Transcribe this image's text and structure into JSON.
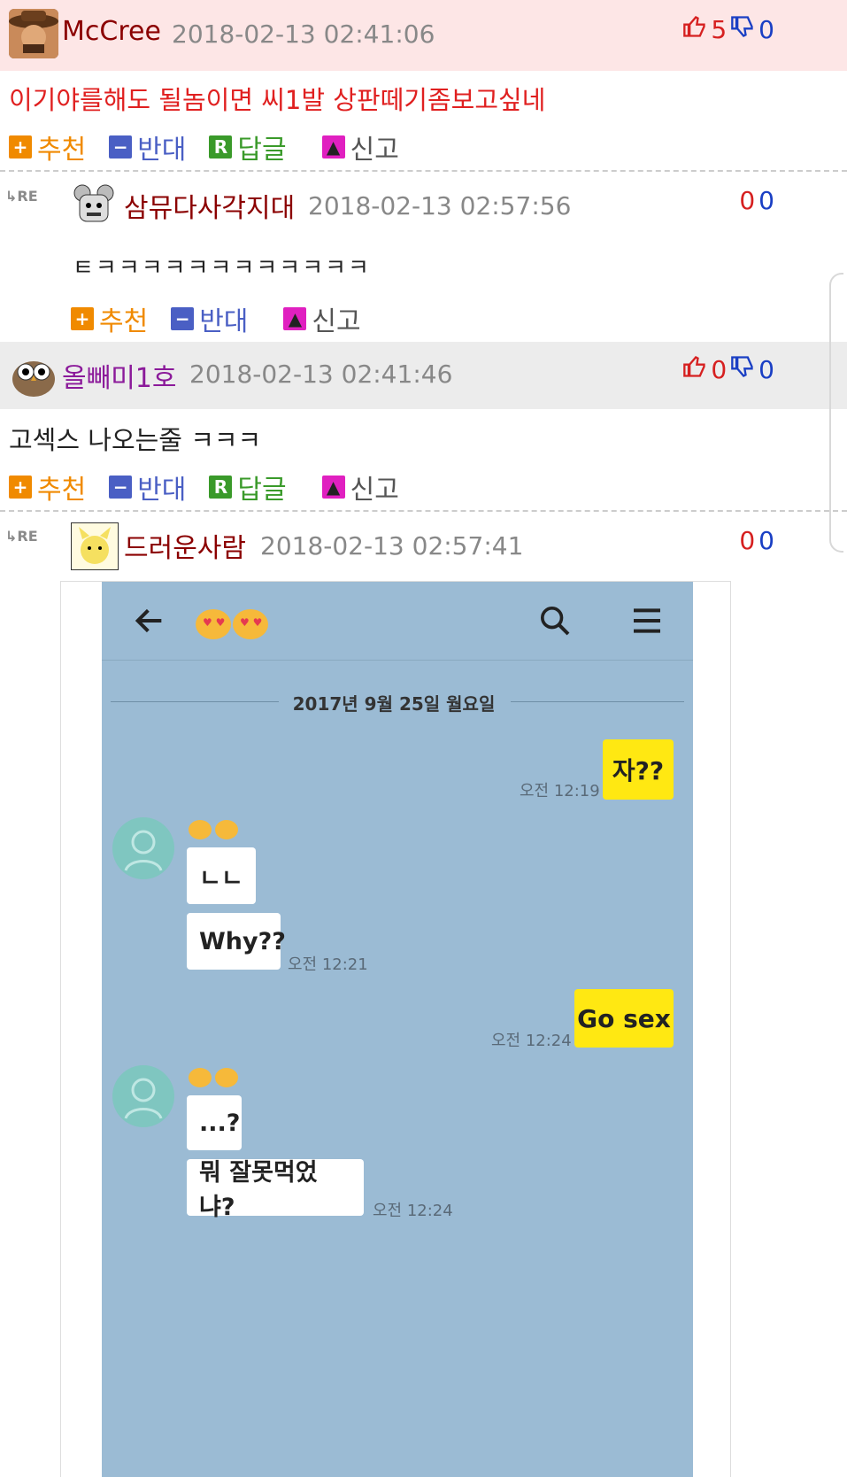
{
  "comments": [
    {
      "nickname": "McCree",
      "date": "2018-02-13 02:41:06",
      "content": "이기야를해도 될놈이면 씨1발 상판떼기좀보고싶네",
      "up": "5",
      "down": "0",
      "actions": {
        "recommend": "추천",
        "oppose": "반대",
        "reply": "답글",
        "report": "신고"
      },
      "colors": {
        "bg": "#fde6e6",
        "nickname": "#8b0000",
        "content": "#e02020"
      }
    },
    {
      "nickname": "올빼미1호",
      "date": "2018-02-13 02:41:46",
      "content": "고섹스 나오는줄 ㅋㅋㅋ",
      "up": "0",
      "down": "0",
      "actions": {
        "recommend": "추천",
        "oppose": "반대",
        "reply": "답글",
        "report": "신고"
      },
      "colors": {
        "bg": "#ececec",
        "nickname": "#8b1a9a",
        "content": "#222222"
      }
    }
  ],
  "replies": [
    {
      "re_label": "RE",
      "nickname": "삼뮤다사각지대",
      "date": "2018-02-13 02:57:56",
      "content": "ㅌㅋㅋㅋㅋㅋㅋㅋㅋㅋㅋㅋㅋ",
      "up": "0",
      "down": "0",
      "actions": {
        "recommend": "추천",
        "oppose": "반대",
        "report": "신고"
      }
    },
    {
      "re_label": "RE",
      "nickname": "드러운사람",
      "date": "2018-02-13 02:57:41",
      "up": "0",
      "down": "0"
    }
  ],
  "kakao": {
    "date_divider": "2017년 9월 25일 월요일",
    "messages": [
      {
        "side": "me",
        "text": "자??",
        "time": "오전 12:19"
      },
      {
        "side": "other",
        "text": "ㄴㄴ"
      },
      {
        "side": "other",
        "text": "Why??",
        "time": "오전 12:21"
      },
      {
        "side": "me",
        "text": "Go sex",
        "time": "오전 12:24"
      },
      {
        "side": "other",
        "text": "...?"
      },
      {
        "side": "other",
        "text": "뭐 잘못먹었냐?",
        "time": "오전 12:24"
      }
    ],
    "icons": [
      "back-arrow-icon",
      "search-icon",
      "menu-icon"
    ],
    "colors": {
      "bg": "#9bbbd4",
      "me_bubble": "#ffe812"
    }
  },
  "icon_colors": {
    "recommend": "#f08a00",
    "oppose": "#4a5fc4",
    "reply": "#3a9a2a",
    "report": "#e020c0"
  }
}
